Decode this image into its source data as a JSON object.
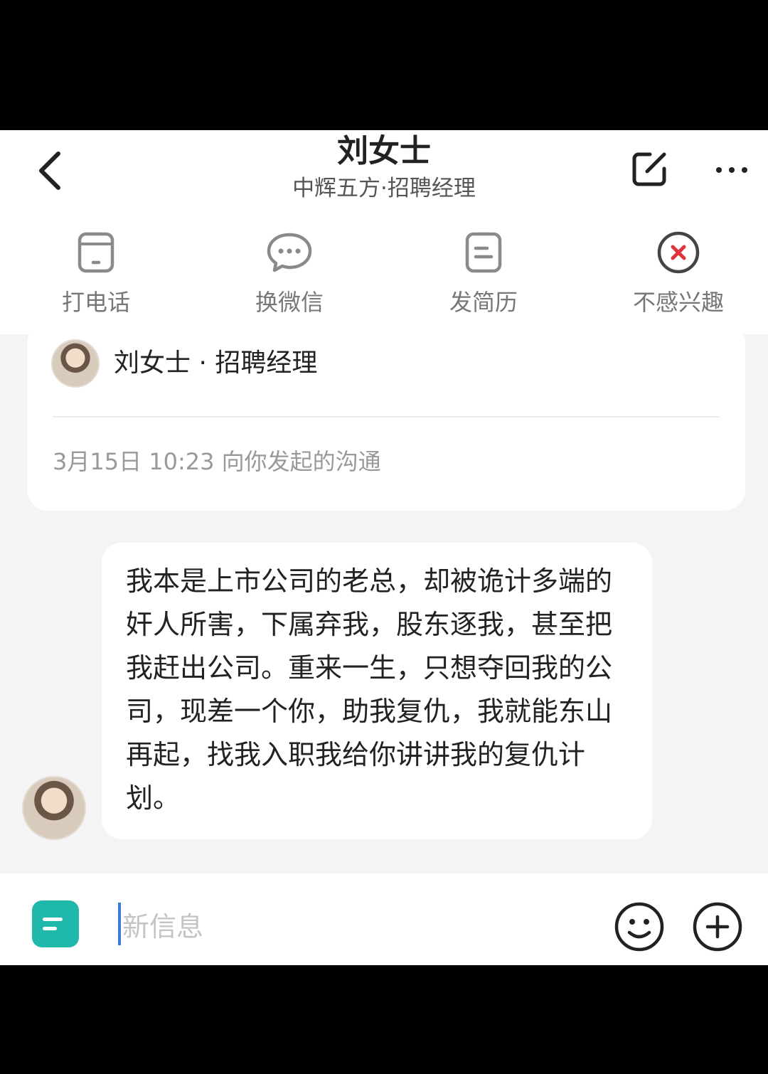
{
  "header": {
    "title": "刘女士",
    "subtitle": "中辉五方·招聘经理",
    "back_icon": "chevron-left-icon",
    "edit_icon": "edit-icon",
    "more_icon": "more-icon"
  },
  "actions": [
    {
      "label": "打电话",
      "icon": "phone-icon"
    },
    {
      "label": "换微信",
      "icon": "chat-bubble-icon"
    },
    {
      "label": "发简历",
      "icon": "resume-icon"
    },
    {
      "label": "不感兴趣",
      "icon": "close-circle-icon"
    }
  ],
  "card": {
    "name": "刘女士 · 招聘经理",
    "time": "3月15日 10:23 向你发起的沟通"
  },
  "message": {
    "text": "我本是上市公司的老总，却被诡计多端的奸人所害，下属弃我，股东逐我，甚至把我赶出公司。重来一生，只想夺回我的公司，现差一个你，助我复仇，我就能东山再起，找我入职我给你讲讲我的复仇计划。"
  },
  "input": {
    "placeholder": "新信息"
  },
  "colors": {
    "accent": "#1fb8ab",
    "close_red": "#e0343c",
    "background": "#f3f4f3"
  }
}
